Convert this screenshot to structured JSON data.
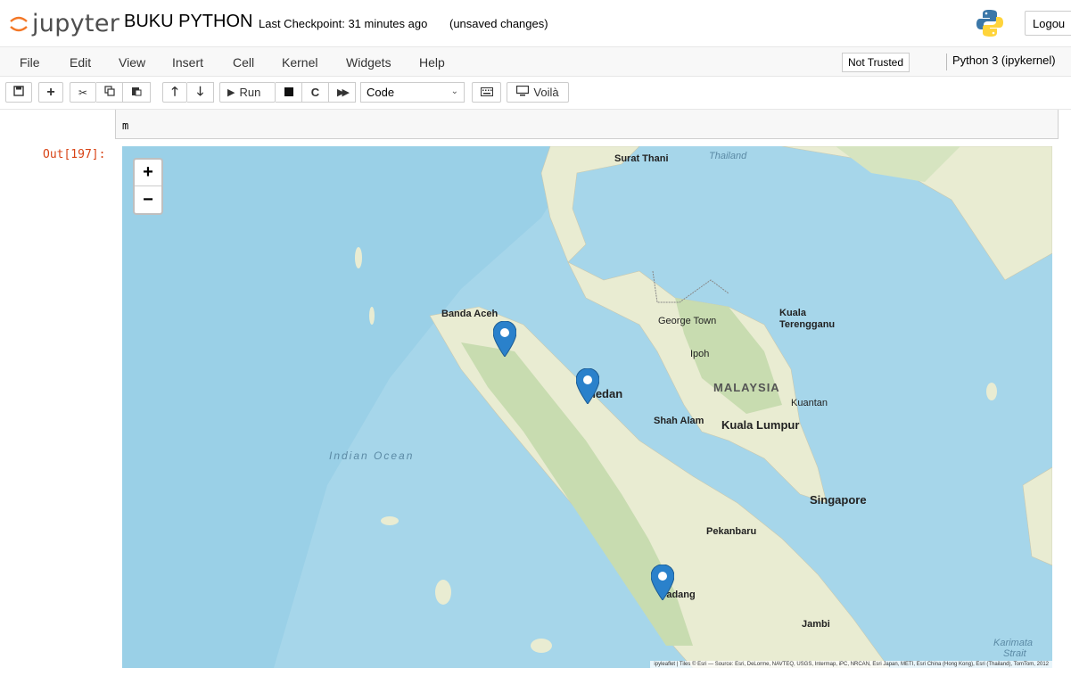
{
  "header": {
    "logo_text": "jupyter",
    "notebook_name": "BUKU PYTHON",
    "checkpoint": "Last Checkpoint: 31 minutes ago",
    "autosave_status": "(unsaved changes)",
    "logout_label": "Logou"
  },
  "menubar": {
    "items": [
      "File",
      "Edit",
      "View",
      "Insert",
      "Cell",
      "Kernel",
      "Widgets",
      "Help"
    ],
    "trust_status": "Not Trusted",
    "kernel": "Python 3 (ipykernel)"
  },
  "toolbar": {
    "run_label": "Run",
    "cell_type": "Code",
    "voila_label": "Voilà"
  },
  "cell": {
    "input_code": "m",
    "out_prompt": "Out[197]:"
  },
  "map": {
    "zoom_in": "+",
    "zoom_out": "−",
    "places": {
      "surat_thani": "Surat Thani",
      "gulf_thailand": "Thailand",
      "banda_aceh": "Banda Aceh",
      "george_town": "George Town",
      "kuala": "Kuala",
      "terengganu": "Terengganu",
      "ipoh": "Ipoh",
      "medan": "Medan",
      "malaysia": "MALAYSIA",
      "kuantan": "Kuantan",
      "shah_alam": "Shah Alam",
      "kuala_lumpur": "Kuala Lumpur",
      "indian_ocean": "Indian Ocean",
      "singapore": "Singapore",
      "pekanbaru": "Pekanbaru",
      "padang": "Padang",
      "jambi": "Jambi",
      "karimata": "Karimata",
      "strait": "Strait"
    },
    "marker_count": 3,
    "attribution": "ipyleaflet | Tiles © Esri — Source: Esri, DeLorme, NAVTEQ, USGS, Intermap, iPC, NRCAN, Esri Japan, METI, Esri China (Hong Kong), Esri (Thailand), TomTom, 2012",
    "colors": {
      "sea": "#a6d6ea",
      "land": "#e9ecd2",
      "forest": "#c8dcb0",
      "marker": "#2a81cb"
    }
  }
}
